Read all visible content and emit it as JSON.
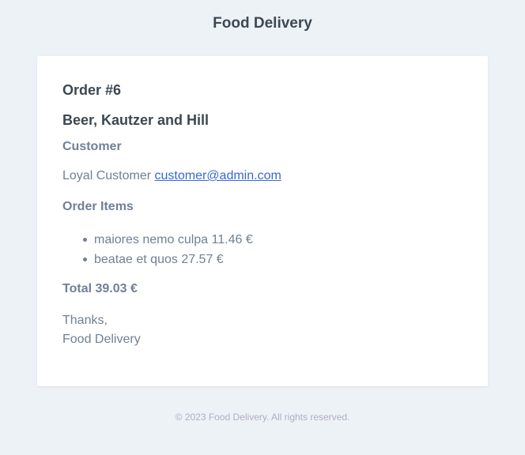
{
  "header": {
    "title": "Food Delivery"
  },
  "order": {
    "title": "Order #6",
    "restaurant": "Beer, Kautzer and Hill",
    "customer_heading": "Customer",
    "customer_name": "Loyal Customer",
    "customer_email": "customer@admin.com",
    "items_heading": "Order Items",
    "items": [
      {
        "text": "maiores nemo culpa 11.46 €"
      },
      {
        "text": "beatae et quos 27.57 €"
      }
    ],
    "total": "Total 39.03 €",
    "thanks": "Thanks,",
    "signature": "Food Delivery"
  },
  "footer": {
    "copyright": "© 2023 Food Delivery. All rights reserved."
  },
  "colors": {
    "background": "#edf2f7",
    "card": "#ffffff",
    "heading": "#3d4852",
    "text": "#718096",
    "link": "#3869d4",
    "footer": "#b0adc5"
  }
}
